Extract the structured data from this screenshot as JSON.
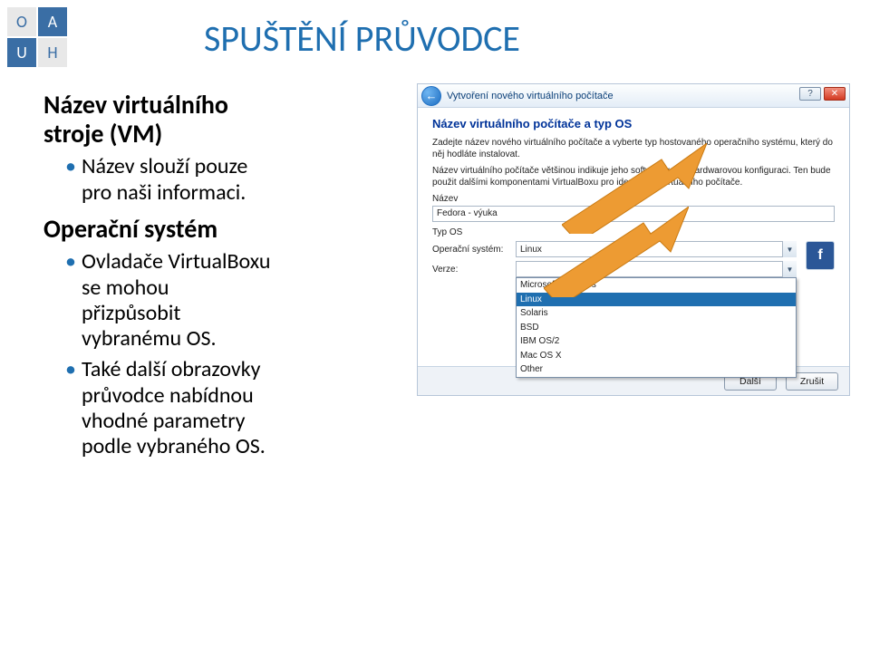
{
  "logo": {
    "tl": "O",
    "tr": "A",
    "bl": "U",
    "br": "H"
  },
  "title": "SPUŠTĚNÍ PRŮVODCE",
  "left": {
    "h1a": "Název virtuálního",
    "h1b": "stroje (VM)",
    "b1a": "Název slouží pouze",
    "b1b": "pro naši informaci.",
    "h2": "Operační systém",
    "b2a": "Ovladače VirtualBoxu",
    "b2b": "se mohou",
    "b2c": "přizpůsobit",
    "b2d": "vybranému OS.",
    "b3a": "Také další obrazovky",
    "b3b": "průvodce nabídnou",
    "b3c": "vhodné parametry",
    "b3d": "podle vybraného OS."
  },
  "dialog": {
    "window_title": "Vytvoření nového virtuálního počítače",
    "step_title": "Název virtuálního počítače a typ OS",
    "para1": "Zadejte název nového virtuálního počítače a vyberte typ hostovaného operačního systému, který do něj hodláte instalovat.",
    "para2": "Název virtuálního počítače většinou indikuje jeho softwarovou a hardwarovou konfiguraci. Ten bude použit dalšími komponentami VirtualBoxu pro identifikaci virtuálního počítače.",
    "label_name": "Název",
    "name_value": "Fedora - výuka",
    "label_typos": "Typ OS",
    "label_os": "Operační systém:",
    "label_ver": "Verze:",
    "os_selected": "Linux",
    "os_options": [
      "Microsoft Windows",
      "Linux",
      "Solaris",
      "BSD",
      "IBM OS/2",
      "Mac OS X",
      "Other"
    ],
    "btn_next": "Další",
    "btn_cancel": "Zrušit",
    "help_icon": "?",
    "close_icon": "✕",
    "back_icon": "←",
    "os_glyph": "f"
  }
}
